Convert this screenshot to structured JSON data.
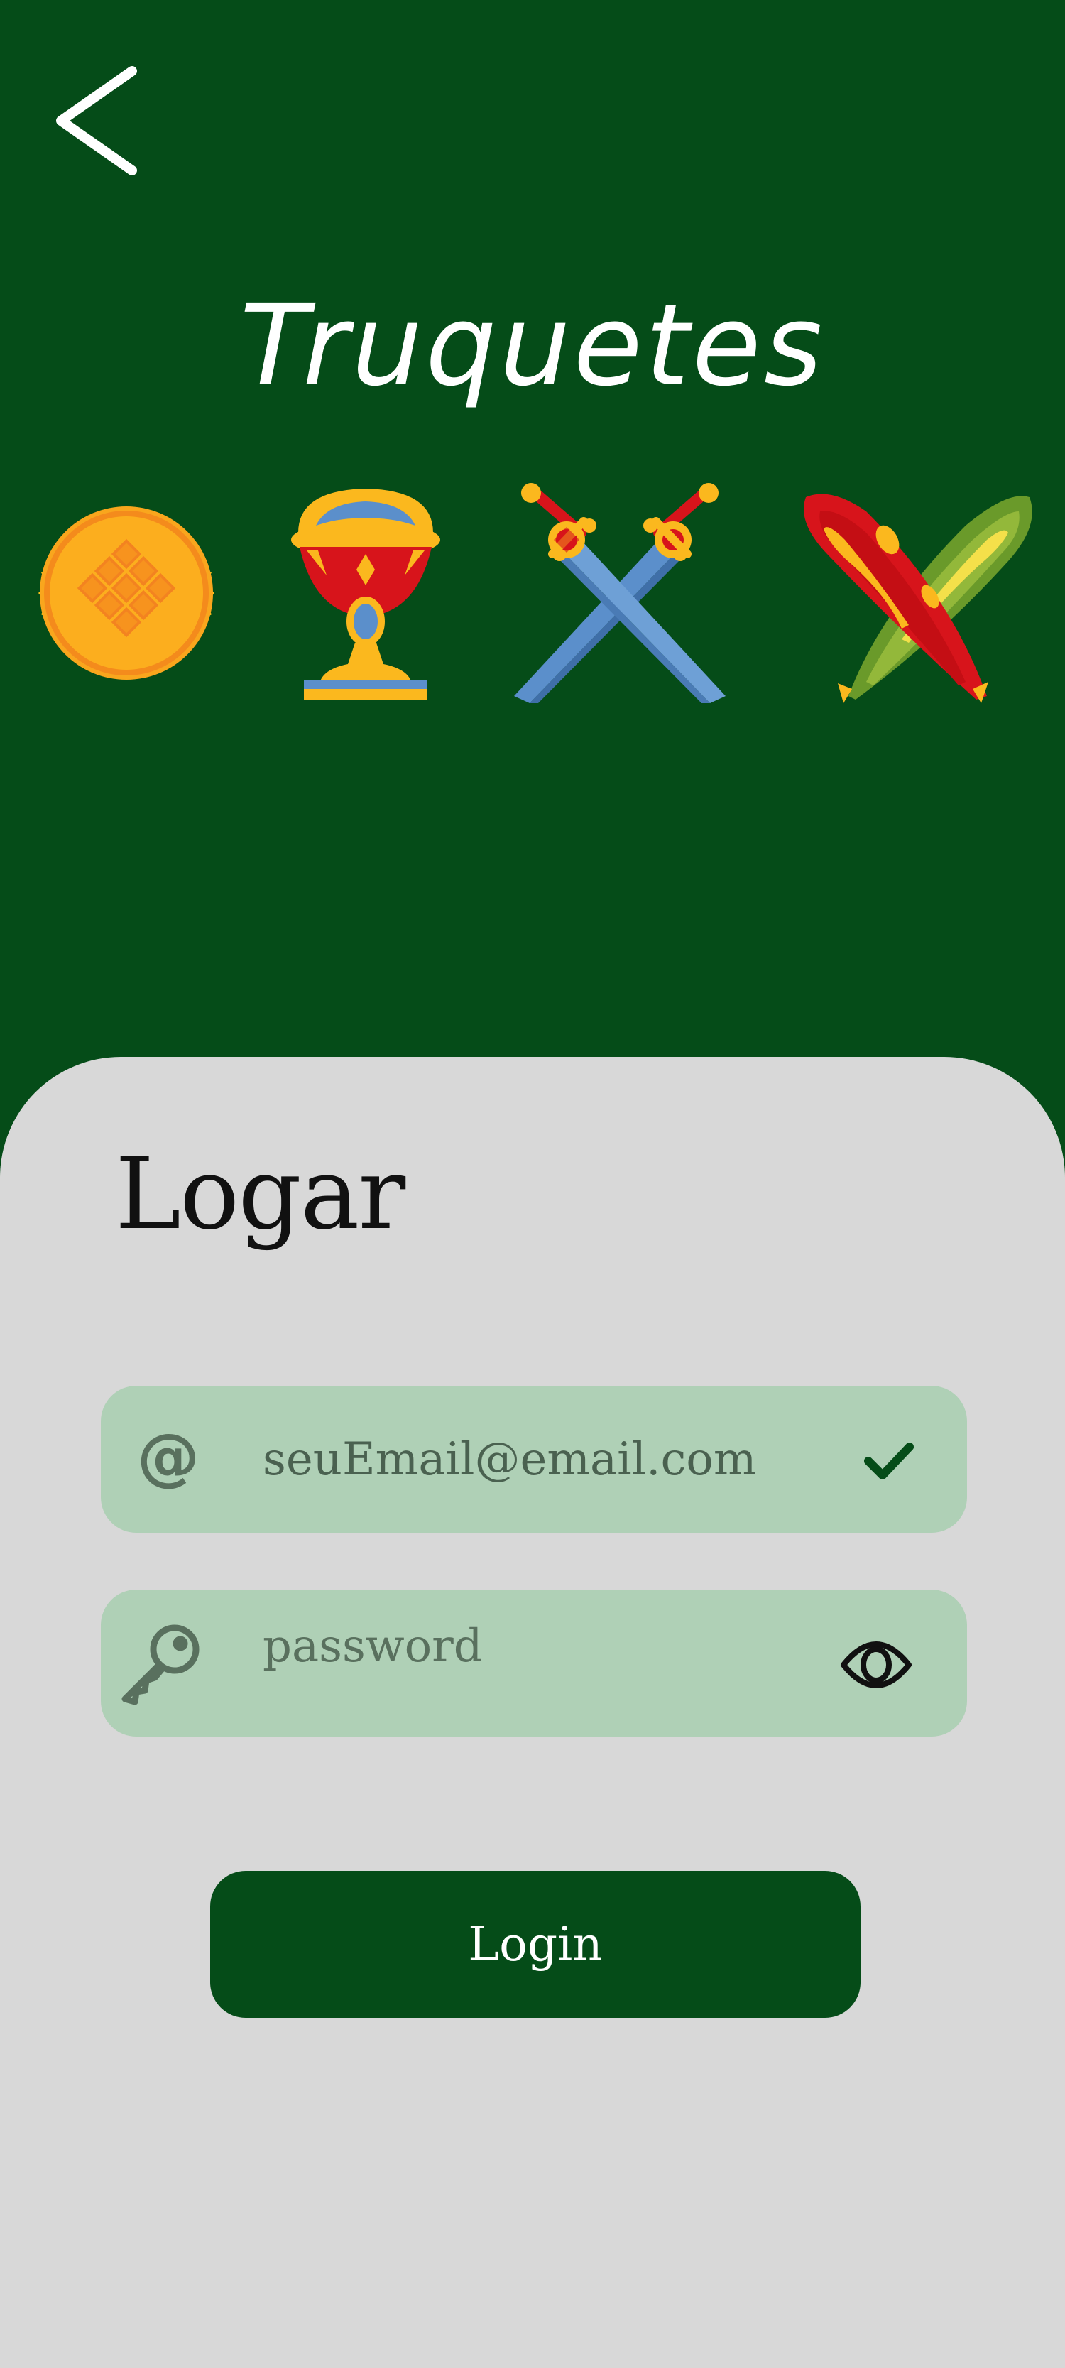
{
  "header": {
    "app_title": "Truquetes",
    "background_color": "#054c18",
    "back_icon": "chevron-left-icon",
    "suits": [
      "coins-icon",
      "cups-icon",
      "swords-icon",
      "clubs-icon"
    ]
  },
  "login_form": {
    "title": "Logar",
    "email": {
      "icon": "at-sign-icon",
      "value": "seuEmail@email.com",
      "status_icon": "check-icon"
    },
    "password": {
      "icon": "key-icon",
      "placeholder": "password",
      "toggle_icon": "eye-icon"
    },
    "submit_label": "Login",
    "field_color": "#afd0b6",
    "panel_color": "#d8d8d8"
  }
}
